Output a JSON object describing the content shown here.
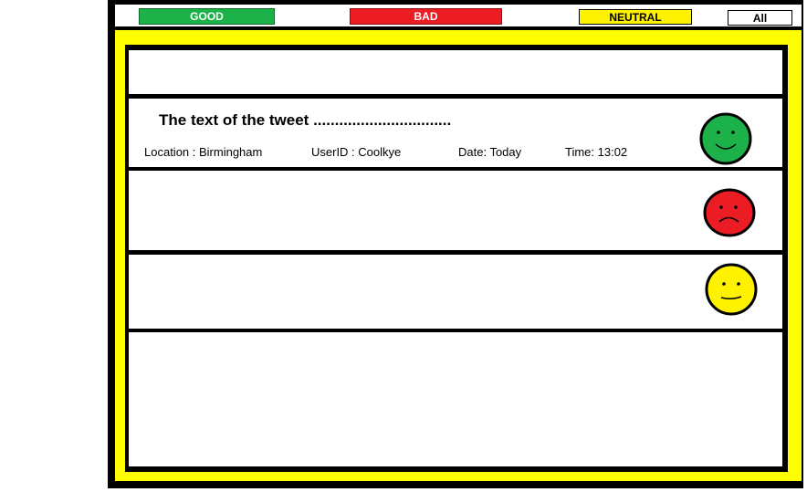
{
  "filters": {
    "good_label": "GOOD",
    "bad_label": "BAD",
    "neutral_label": "NEUTRAL",
    "all_label": "All"
  },
  "colors": {
    "good": "#1db14a",
    "bad": "#ec1c24",
    "neutral": "#fff200",
    "panel": "#ffff00"
  },
  "tweet": {
    "text": "The text of the tweet ................................",
    "location": "Location : Birmingham",
    "user": "UserID : Coolkye",
    "date": "Date: Today",
    "time": "Time: 13:02",
    "sentiment_icon": "happy-face-icon"
  },
  "rows": [
    {
      "sentiment_icon": "sad-face-icon"
    },
    {
      "sentiment_icon": "neutral-face-icon"
    }
  ]
}
